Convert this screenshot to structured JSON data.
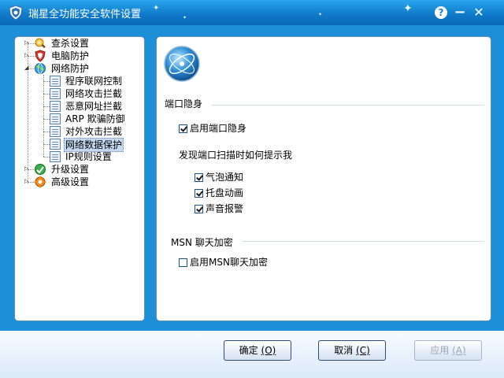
{
  "window": {
    "title": "瑞星全功能安全软件设置",
    "help_label": "?",
    "minimize_label": "−",
    "close_label": "✕"
  },
  "tree": {
    "items": [
      {
        "label": "查杀设置",
        "icon": "search-kill-icon",
        "expander": "plus"
      },
      {
        "label": "电脑防护",
        "icon": "shield-icon",
        "expander": "plus"
      },
      {
        "label": "网络防护",
        "icon": "globe-icon",
        "expander": "minus"
      },
      {
        "label": "程序联网控制",
        "icon": "page-icon"
      },
      {
        "label": "网络攻击拦截",
        "icon": "page-icon"
      },
      {
        "label": "恶意网址拦截",
        "icon": "page-icon"
      },
      {
        "label": "ARP 欺骗防御",
        "icon": "page-icon"
      },
      {
        "label": "对外攻击拦截",
        "icon": "page-icon"
      },
      {
        "label": "网络数据保护",
        "icon": "page-icon",
        "selected": true
      },
      {
        "label": "IP规则设置",
        "icon": "page-icon"
      },
      {
        "label": "升级设置",
        "icon": "update-icon",
        "expander": "plus"
      },
      {
        "label": "高级设置",
        "icon": "gear-icon",
        "expander": "plus"
      }
    ]
  },
  "port_stealth": {
    "section_title": "端口隐身",
    "enable_label": "启用端口隐身",
    "enable_checked": true,
    "notify_heading": "发现端口扫描时如何提示我",
    "options": [
      {
        "label": "气泡通知",
        "checked": true
      },
      {
        "label": "托盘动画",
        "checked": true
      },
      {
        "label": "声音报警",
        "checked": true
      }
    ]
  },
  "msn": {
    "section_title": "MSN 聊天加密",
    "enable_label": "启用MSN聊天加密",
    "enable_checked": false
  },
  "buttons": {
    "ok_label": "确定",
    "ok_key": "(O)",
    "cancel_label": "取消",
    "cancel_key": "(C)",
    "apply_label": "应用",
    "apply_key": "(A)"
  },
  "colors": {
    "titlebar": "#0f78c8",
    "body_background": "#1d8fd8",
    "selection": "#c5d8f0"
  }
}
